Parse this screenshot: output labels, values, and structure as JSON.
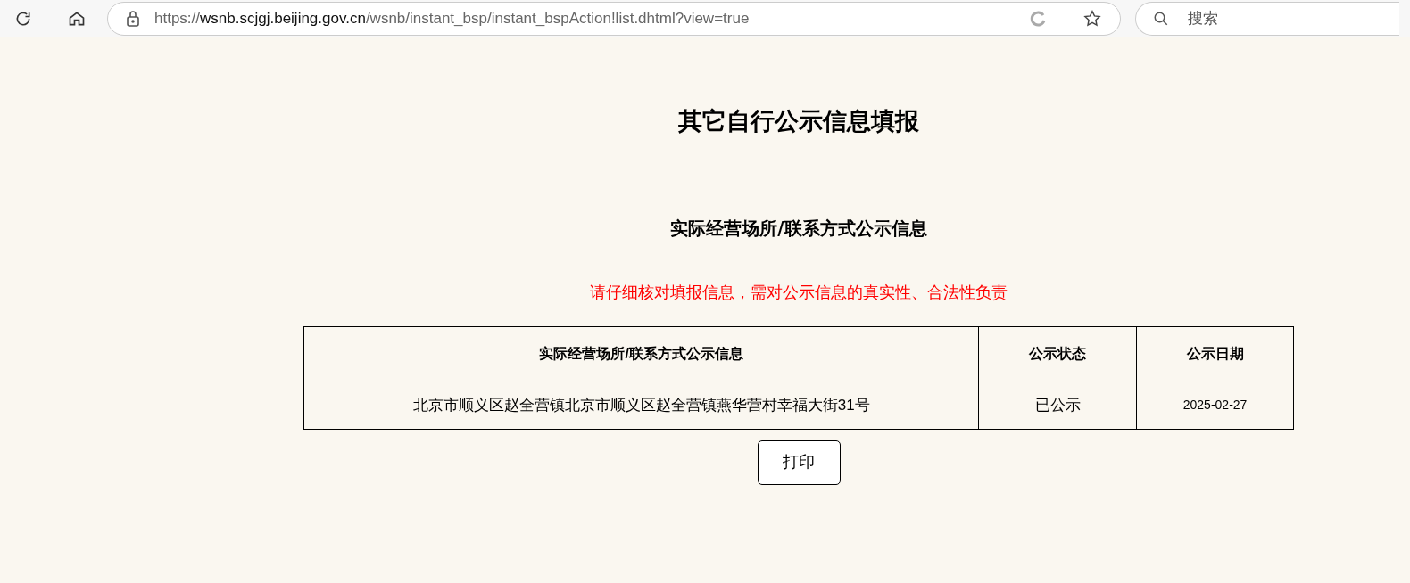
{
  "browser": {
    "url": {
      "scheme": "https://",
      "host": "wsnb.scjgj.beijing.gov.cn",
      "path": "/wsnb/instant_bsp/instant_bspAction!list.dhtml?view=true"
    },
    "search_placeholder": "搜索"
  },
  "page": {
    "title": "其它自行公示信息填报",
    "subtitle": "实际经营场所/联系方式公示信息",
    "notice": "请仔细核对填报信息，需对公示信息的真实性、合法性负责",
    "table": {
      "columns": [
        "实际经营场所/联系方式公示信息",
        "公示状态",
        "公示日期"
      ],
      "rows": [
        [
          "北京市顺义区赵全营镇北京市顺义区赵全营镇燕华营村幸福大街31号",
          "已公示",
          "2025-02-27"
        ]
      ]
    },
    "print_button": "打印"
  }
}
